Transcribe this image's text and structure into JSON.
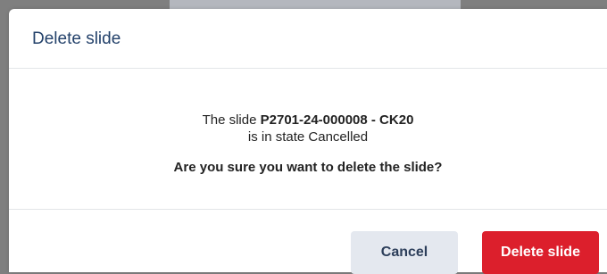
{
  "dialog": {
    "title": "Delete slide",
    "message": {
      "prefix": "The slide ",
      "slide_id": "P2701-24-000008 - CK20",
      "state_line": "is in state Cancelled",
      "question": "Are you sure you want to delete the slide?"
    },
    "buttons": {
      "cancel": "Cancel",
      "delete": "Delete slide"
    }
  },
  "colors": {
    "title": "#24426b",
    "delete_button": "#dc1f2c",
    "cancel_button": "#e4e8ef"
  }
}
